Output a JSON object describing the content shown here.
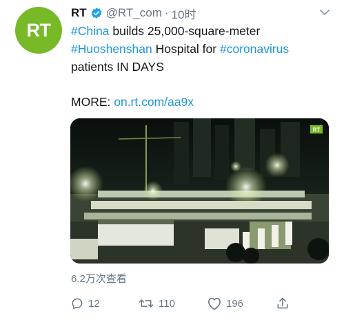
{
  "tweet": {
    "avatar_text": "RT",
    "display_name": "RT",
    "handle": "@RT_com",
    "separator": "·",
    "time": "10时",
    "text_lines": [
      [
        {
          "t": "#China",
          "link": true
        },
        {
          "t": " builds 25,000-square-meter",
          "link": false
        }
      ],
      [
        {
          "t": "#Huoshenshan",
          "link": true
        },
        {
          "t": " Hospital for ",
          "link": false
        },
        {
          "t": "#coronavirus",
          "link": true
        }
      ],
      [
        {
          "t": "patients IN DAYS",
          "link": false
        }
      ]
    ],
    "more_label": "MORE: ",
    "more_link": "on.rt.com/aa9x",
    "media_badge": "RT",
    "views": "6.2万次查看"
  },
  "actions": {
    "reply_count": "12",
    "retweet_count": "110",
    "like_count": "196"
  },
  "colors": {
    "brand_green": "#78b928",
    "link_blue": "#1b95e0",
    "verified_blue": "#1da1f2",
    "muted_gray": "#657786"
  },
  "icons": [
    "verified-badge-icon",
    "chevron-down-icon",
    "reply-icon",
    "retweet-icon",
    "like-icon",
    "share-icon"
  ]
}
